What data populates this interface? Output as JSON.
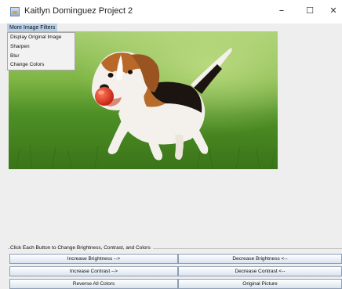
{
  "window": {
    "title": "Kaitlyn Dominguez Project 2",
    "minimize": "–",
    "maximize": "☐",
    "close": "✕"
  },
  "menu": {
    "title": "More Image Filters",
    "items": [
      {
        "label": "Display Original Image"
      },
      {
        "label": "Sharpen"
      },
      {
        "label": "Blur"
      },
      {
        "label": "Change Colors"
      }
    ]
  },
  "controls": {
    "instructions": "Click Each Button to Change Brightness, Contrast, and Colors",
    "buttons": [
      {
        "label": "Increase Brightness -->"
      },
      {
        "label": "Decrease Brightness <--"
      },
      {
        "label": "Increase Contrast -->"
      },
      {
        "label": "Decrease Contrast <--"
      },
      {
        "label": "Reverse All Colors"
      },
      {
        "label": "Original Picture"
      }
    ]
  }
}
